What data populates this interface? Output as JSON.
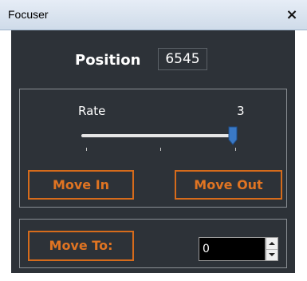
{
  "window": {
    "title": "Focuser",
    "close_label": "×"
  },
  "position": {
    "label": "Position",
    "value": "6545"
  },
  "rate": {
    "label": "Rate",
    "value": "3",
    "slider_level": 0.95
  },
  "buttons": {
    "move_in": "Move In",
    "move_out": "Move Out",
    "move_to": "Move To:"
  },
  "move_to_input": {
    "value": "0"
  },
  "colors": {
    "panel": "#2d3238",
    "accent": "#d66b1b",
    "thumb": "#3a79c6"
  },
  "icons": {
    "close": "close-icon",
    "spin_up": "arrow-up-icon",
    "spin_down": "arrow-down-icon"
  }
}
